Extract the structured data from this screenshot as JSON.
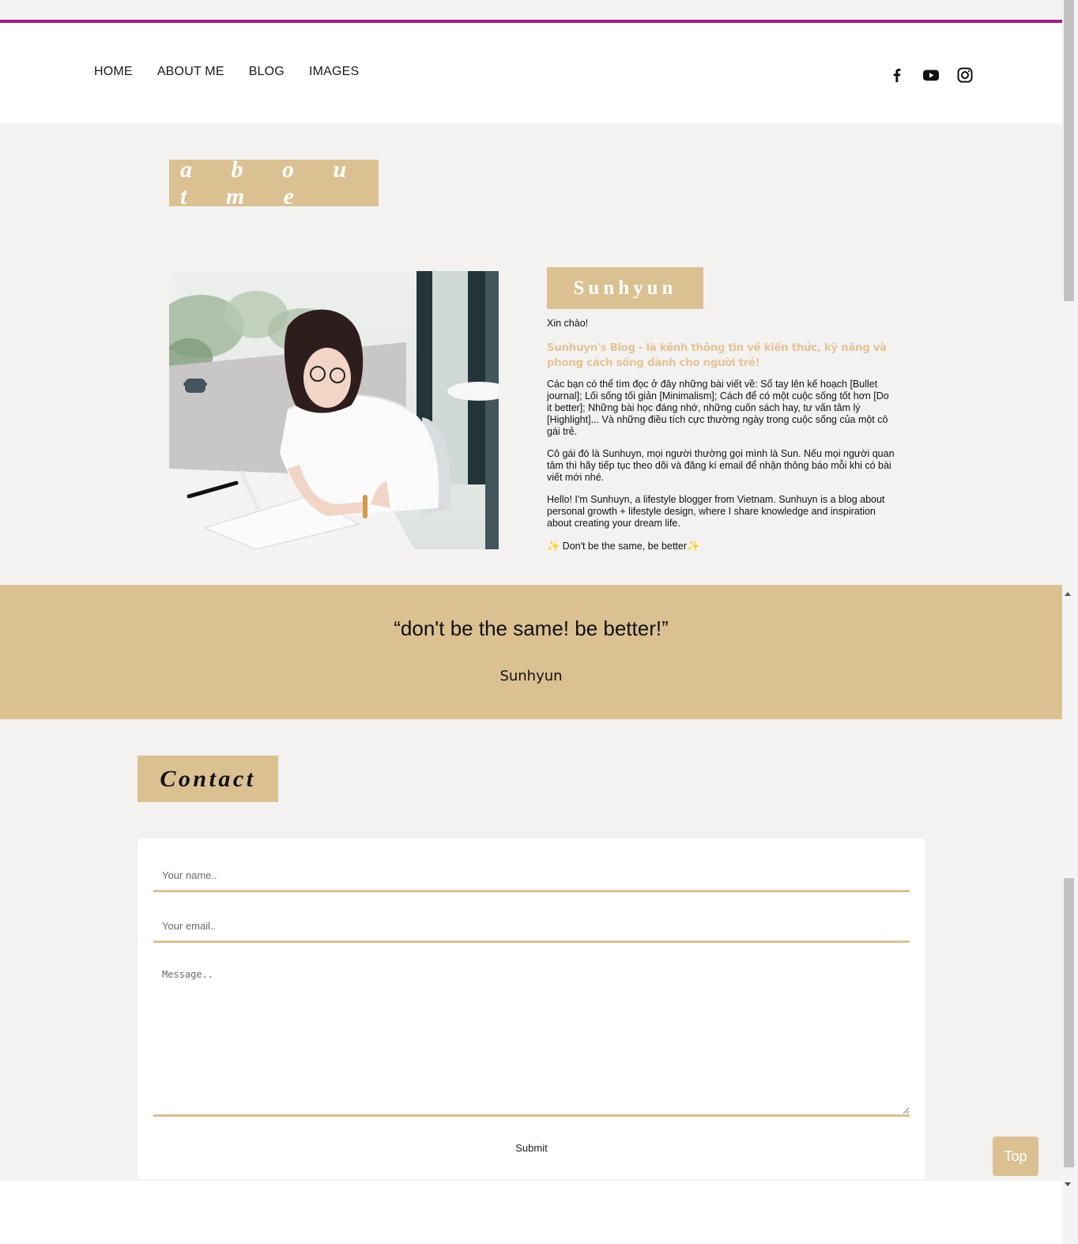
{
  "nav": {
    "items": [
      "HOME",
      "ABOUT ME",
      "BLOG",
      "IMAGES"
    ]
  },
  "social": {
    "icons": [
      "facebook-icon",
      "youtube-icon",
      "instagram-icon"
    ]
  },
  "about": {
    "title": "a b o u t m e",
    "name": "Sunhyun",
    "greeting": "Xin chào!",
    "highlight": "Sunhuyn's Blog - là kênh thông tin về kiến thức, kỹ năng và phong cách sống dành cho người trẻ!",
    "paragraph1": "Các bạn có thể tìm đọc ở đây những bài viết về: Sổ tay lên kế hoạch [Bullet journal]; Lối sống tối giản [Minimalism]; Cách để có một cuộc sống tốt hơn [Do it better]; Những bài học đáng nhớ, những cuốn sách hay, tư vấn tâm lý [Highlight]... Và những điều tích cực thường ngày trong cuộc sống của một cô gái trẻ.",
    "paragraph2": "Cô gái đó là Sunhuyn, mọi người thường gọi mình là Sun. Nếu mọi người quan tâm thì hãy tiếp tục theo dõi và đăng kí email để nhận thông báo mỗi khi có bài viết mới nhé.",
    "paragraph3": "Hello! I'm Sunhuyn, a lifestyle blogger from Vietnam. Sunhuyn is a blog about personal growth + lifestyle design, where I share knowledge and inspiration about creating your dream life.",
    "motto": "Don't be the same, be better",
    "motto_icon": "sparkle-icon"
  },
  "quote": {
    "text": "“don't be the same! be better!”",
    "author": "Sunhyun"
  },
  "contact": {
    "title": "Contact",
    "name_placeholder": "Your name..",
    "email_placeholder": "Your email..",
    "message_placeholder": "Message..",
    "submit_label": "Submit"
  },
  "top_button": {
    "label": "Top"
  },
  "colors": {
    "accent_line": "#9c1c8c",
    "gold": "#dbc192",
    "background": "#f4f2f1",
    "highlight_text": "#e2c495"
  }
}
